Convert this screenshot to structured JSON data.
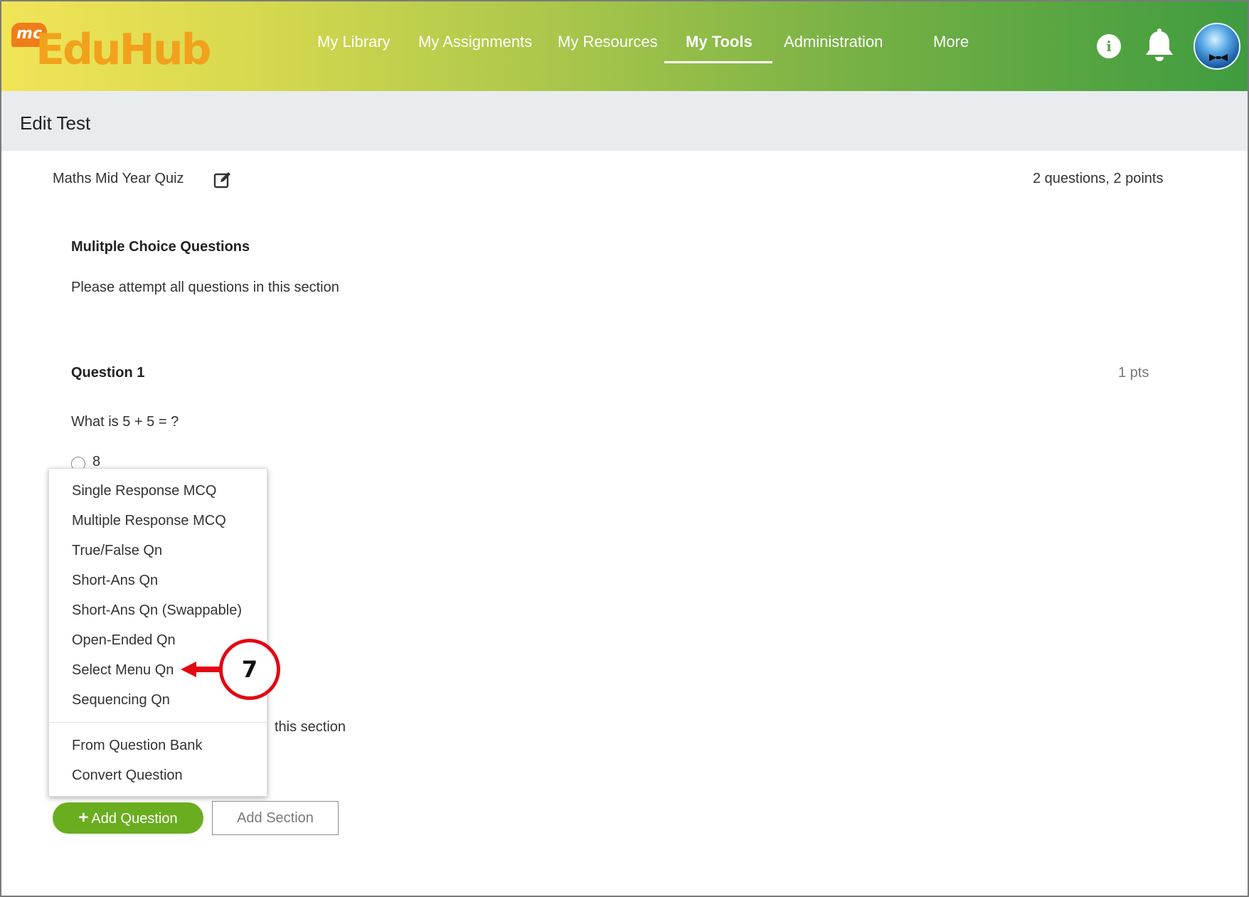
{
  "app": {
    "logo_badge": "mc",
    "logo_text": "EduHub"
  },
  "nav": {
    "items": [
      {
        "label": "My Library"
      },
      {
        "label": "My Assignments"
      },
      {
        "label": "My Resources"
      },
      {
        "label": "My Tools",
        "active": true
      },
      {
        "label": "Administration"
      },
      {
        "label": "More"
      }
    ],
    "info_icon": "info-icon",
    "bell_icon": "bell-icon",
    "info_glyph": "i"
  },
  "page": {
    "title": "Edit Test"
  },
  "test": {
    "name": "Maths Mid Year Quiz",
    "summary": "2 questions, 2 points"
  },
  "section": {
    "title": "Mulitple Choice Questions",
    "instructions": "Please attempt all questions in this section"
  },
  "question": {
    "label": "Question 1",
    "points": "1 pts",
    "text": "What is 5 + 5 = ?",
    "options": [
      "8"
    ]
  },
  "section2": {
    "instructions_visible": "this section"
  },
  "dropdown": {
    "items": [
      "Single Response MCQ",
      "Multiple Response MCQ",
      "True/False Qn",
      "Short-Ans Qn",
      "Short-Ans Qn (Swappable)",
      "Open-Ended Qn",
      "Select Menu Qn",
      "Sequencing Qn"
    ],
    "extra_items": [
      "From Question Bank",
      "Convert Question"
    ]
  },
  "buttons": {
    "add_question_plus": "+",
    "add_question": "Add Question",
    "add_section": "Add Section"
  },
  "callout": {
    "number": "7"
  },
  "colors": {
    "accent_green": "#6aae1f",
    "callout_red": "#e30613",
    "logo_orange": "#f2a11c"
  }
}
